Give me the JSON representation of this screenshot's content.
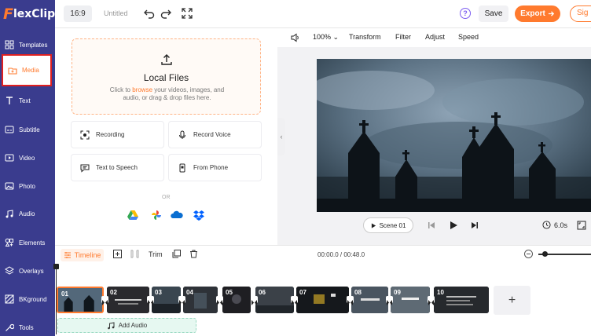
{
  "header": {
    "logo_f": "F",
    "logo_rest": "lexClip",
    "ratio": "16:9",
    "title": "Untitled",
    "save_label": "Save",
    "export_label": "Export",
    "signin_label": "Sig",
    "help_glyph": "?"
  },
  "sidebar": {
    "items": [
      {
        "label": "Templates",
        "icon": "templates-icon"
      },
      {
        "label": "Media",
        "icon": "media-folder-icon",
        "active": true
      },
      {
        "label": "Text",
        "icon": "text-icon"
      },
      {
        "label": "Subtitle",
        "icon": "subtitle-icon"
      },
      {
        "label": "Video",
        "icon": "video-icon"
      },
      {
        "label": "Photo",
        "icon": "photo-icon"
      },
      {
        "label": "Audio",
        "icon": "audio-icon"
      },
      {
        "label": "Elements",
        "icon": "elements-icon"
      },
      {
        "label": "Overlays",
        "icon": "overlays-icon"
      },
      {
        "label": "BKground",
        "icon": "background-icon"
      },
      {
        "label": "Tools",
        "icon": "tools-icon"
      }
    ]
  },
  "media": {
    "title": "Local Files",
    "desc_before": "Click to ",
    "desc_browse": "browse",
    "desc_after": " your videos, images, and audio, or drag & drop files here.",
    "options": [
      {
        "label": "Recording",
        "icon": "screen-record-icon"
      },
      {
        "label": "Record Voice",
        "icon": "microphone-icon"
      },
      {
        "label": "Text to Speech",
        "icon": "text-to-speech-icon"
      },
      {
        "label": "From Phone",
        "icon": "phone-icon"
      }
    ],
    "or": "OR",
    "cloud_sources": [
      "google-drive-icon",
      "google-photos-icon",
      "onedrive-icon",
      "dropbox-icon"
    ]
  },
  "preview": {
    "zoom": "100%",
    "tools": [
      "Transform",
      "Filter",
      "Adjust",
      "Speed"
    ],
    "scene_label": "Scene 01",
    "duration": "6.0s"
  },
  "timeline": {
    "label": "Timeline",
    "trim_label": "Trim",
    "time": "00:00.0 / 00:48.0",
    "clips": [
      "01",
      "02",
      "03",
      "04",
      "05",
      "06",
      "07",
      "08",
      "09",
      "10"
    ],
    "add_audio_label": "Add Audio",
    "add_clip_glyph": "+"
  },
  "colors": {
    "sidebar": "#3a3c8e",
    "accent": "#ff7a2e",
    "help": "#7b5cf0"
  }
}
